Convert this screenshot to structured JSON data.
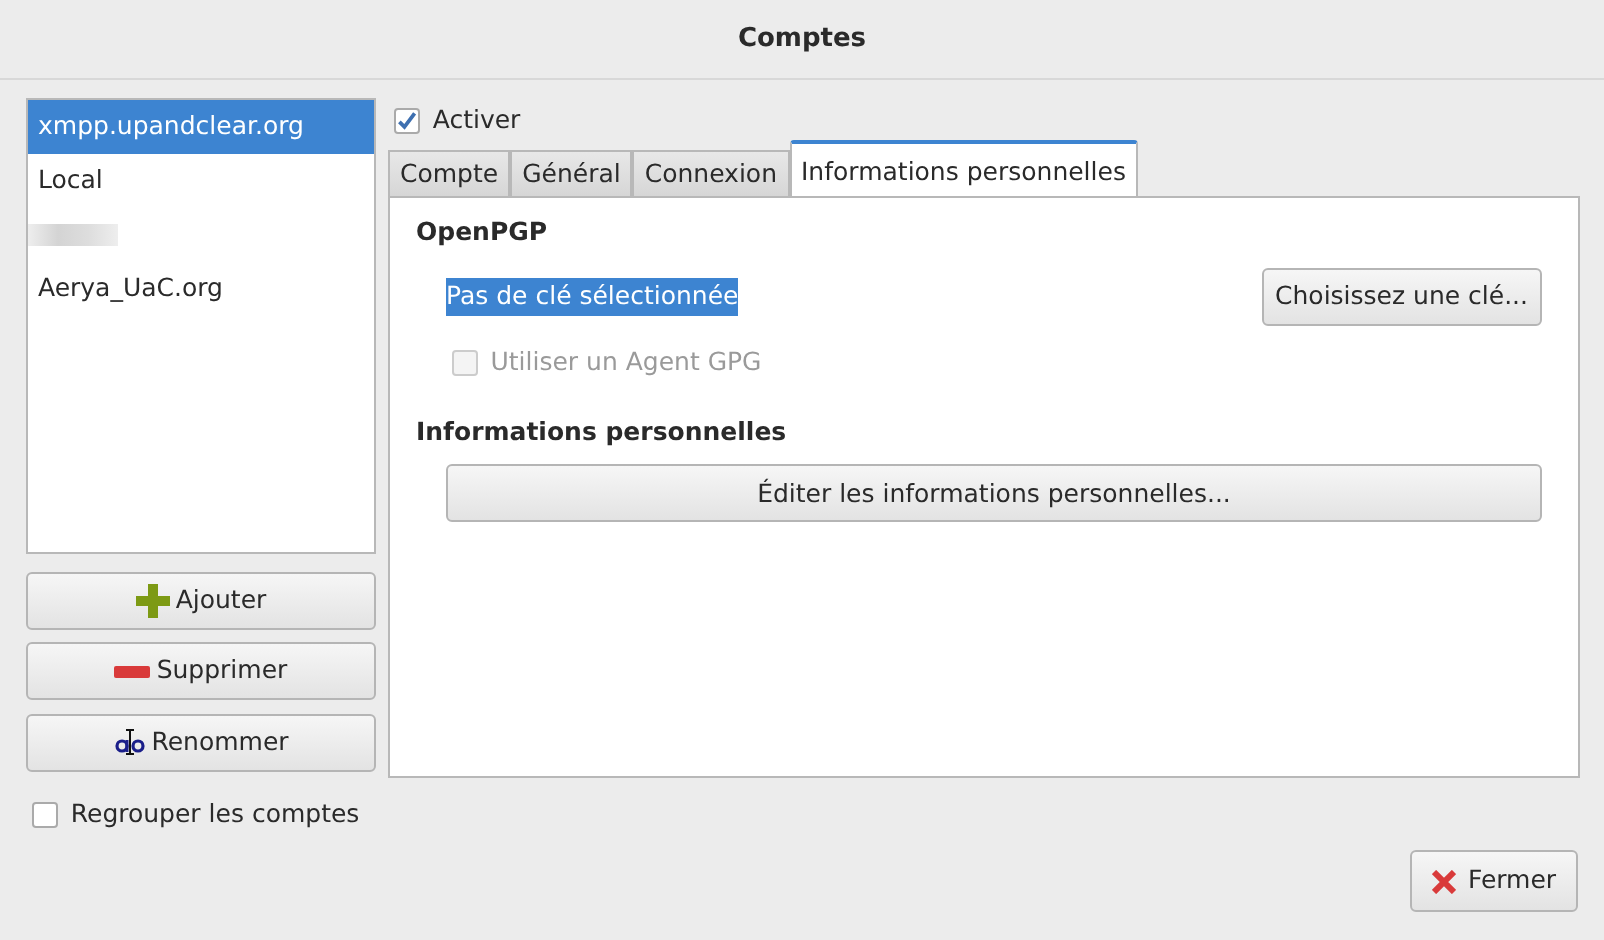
{
  "window": {
    "title": "Comptes"
  },
  "accounts": [
    {
      "kind": "text",
      "label": "xmpp.upandclear.org",
      "selected": true
    },
    {
      "kind": "text",
      "label": "Local",
      "selected": false
    },
    {
      "kind": "redacted",
      "selected": false
    },
    {
      "kind": "text",
      "label": "Aerya_UaC.org",
      "selected": false
    }
  ],
  "account_buttons": [
    {
      "kind": "add",
      "label": "Ajouter"
    },
    {
      "kind": "remove",
      "label": "Supprimer"
    },
    {
      "kind": "rename",
      "label": "Renommer"
    }
  ],
  "group_accounts": {
    "label": "Regrouper les comptes",
    "checked": false
  },
  "enable": {
    "label": "Activer",
    "checked": true
  },
  "tabs": [
    {
      "label": "Compte",
      "selected": false
    },
    {
      "label": "Général",
      "selected": false
    },
    {
      "label": "Connexion",
      "selected": false
    },
    {
      "label": "Informations personnelles",
      "selected": true
    }
  ],
  "openpgp": {
    "heading": "OpenPGP",
    "key_status": {
      "text": "Pas de clé sélectionnée",
      "selected": true
    },
    "choose_button": "Choisissez une clé...",
    "gpg_agent": {
      "label": "Utiliser un Agent GPG",
      "checked": false,
      "disabled": true
    }
  },
  "personal_info": {
    "heading": "Informations personnelles",
    "edit_button": "Éditer les informations personnelles..."
  },
  "close_button": "Fermer"
}
